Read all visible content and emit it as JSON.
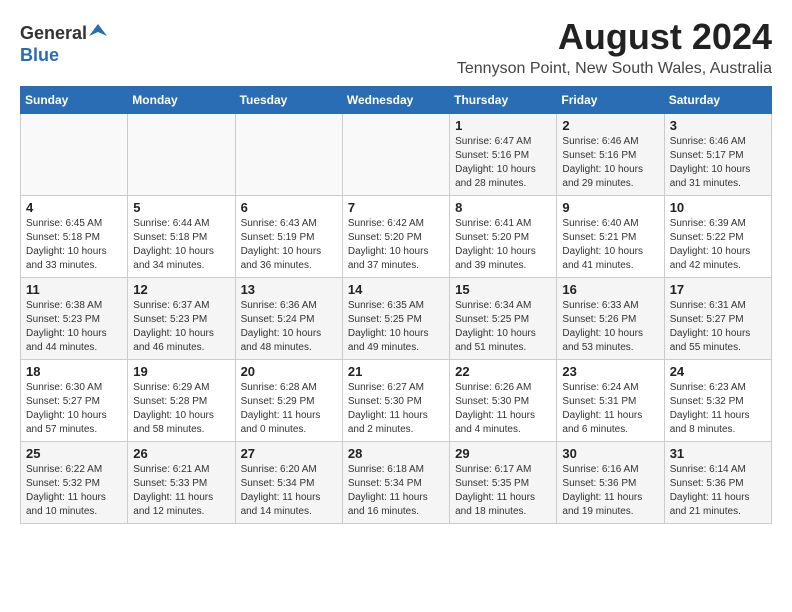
{
  "logo": {
    "general": "General",
    "blue": "Blue"
  },
  "title": "August 2024",
  "subtitle": "Tennyson Point, New South Wales, Australia",
  "calendar": {
    "headers": [
      "Sunday",
      "Monday",
      "Tuesday",
      "Wednesday",
      "Thursday",
      "Friday",
      "Saturday"
    ],
    "weeks": [
      [
        {
          "day": "",
          "info": ""
        },
        {
          "day": "",
          "info": ""
        },
        {
          "day": "",
          "info": ""
        },
        {
          "day": "",
          "info": ""
        },
        {
          "day": "1",
          "info": "Sunrise: 6:47 AM\nSunset: 5:16 PM\nDaylight: 10 hours\nand 28 minutes."
        },
        {
          "day": "2",
          "info": "Sunrise: 6:46 AM\nSunset: 5:16 PM\nDaylight: 10 hours\nand 29 minutes."
        },
        {
          "day": "3",
          "info": "Sunrise: 6:46 AM\nSunset: 5:17 PM\nDaylight: 10 hours\nand 31 minutes."
        }
      ],
      [
        {
          "day": "4",
          "info": "Sunrise: 6:45 AM\nSunset: 5:18 PM\nDaylight: 10 hours\nand 33 minutes."
        },
        {
          "day": "5",
          "info": "Sunrise: 6:44 AM\nSunset: 5:18 PM\nDaylight: 10 hours\nand 34 minutes."
        },
        {
          "day": "6",
          "info": "Sunrise: 6:43 AM\nSunset: 5:19 PM\nDaylight: 10 hours\nand 36 minutes."
        },
        {
          "day": "7",
          "info": "Sunrise: 6:42 AM\nSunset: 5:20 PM\nDaylight: 10 hours\nand 37 minutes."
        },
        {
          "day": "8",
          "info": "Sunrise: 6:41 AM\nSunset: 5:20 PM\nDaylight: 10 hours\nand 39 minutes."
        },
        {
          "day": "9",
          "info": "Sunrise: 6:40 AM\nSunset: 5:21 PM\nDaylight: 10 hours\nand 41 minutes."
        },
        {
          "day": "10",
          "info": "Sunrise: 6:39 AM\nSunset: 5:22 PM\nDaylight: 10 hours\nand 42 minutes."
        }
      ],
      [
        {
          "day": "11",
          "info": "Sunrise: 6:38 AM\nSunset: 5:23 PM\nDaylight: 10 hours\nand 44 minutes."
        },
        {
          "day": "12",
          "info": "Sunrise: 6:37 AM\nSunset: 5:23 PM\nDaylight: 10 hours\nand 46 minutes."
        },
        {
          "day": "13",
          "info": "Sunrise: 6:36 AM\nSunset: 5:24 PM\nDaylight: 10 hours\nand 48 minutes."
        },
        {
          "day": "14",
          "info": "Sunrise: 6:35 AM\nSunset: 5:25 PM\nDaylight: 10 hours\nand 49 minutes."
        },
        {
          "day": "15",
          "info": "Sunrise: 6:34 AM\nSunset: 5:25 PM\nDaylight: 10 hours\nand 51 minutes."
        },
        {
          "day": "16",
          "info": "Sunrise: 6:33 AM\nSunset: 5:26 PM\nDaylight: 10 hours\nand 53 minutes."
        },
        {
          "day": "17",
          "info": "Sunrise: 6:31 AM\nSunset: 5:27 PM\nDaylight: 10 hours\nand 55 minutes."
        }
      ],
      [
        {
          "day": "18",
          "info": "Sunrise: 6:30 AM\nSunset: 5:27 PM\nDaylight: 10 hours\nand 57 minutes."
        },
        {
          "day": "19",
          "info": "Sunrise: 6:29 AM\nSunset: 5:28 PM\nDaylight: 10 hours\nand 58 minutes."
        },
        {
          "day": "20",
          "info": "Sunrise: 6:28 AM\nSunset: 5:29 PM\nDaylight: 11 hours\nand 0 minutes."
        },
        {
          "day": "21",
          "info": "Sunrise: 6:27 AM\nSunset: 5:30 PM\nDaylight: 11 hours\nand 2 minutes."
        },
        {
          "day": "22",
          "info": "Sunrise: 6:26 AM\nSunset: 5:30 PM\nDaylight: 11 hours\nand 4 minutes."
        },
        {
          "day": "23",
          "info": "Sunrise: 6:24 AM\nSunset: 5:31 PM\nDaylight: 11 hours\nand 6 minutes."
        },
        {
          "day": "24",
          "info": "Sunrise: 6:23 AM\nSunset: 5:32 PM\nDaylight: 11 hours\nand 8 minutes."
        }
      ],
      [
        {
          "day": "25",
          "info": "Sunrise: 6:22 AM\nSunset: 5:32 PM\nDaylight: 11 hours\nand 10 minutes."
        },
        {
          "day": "26",
          "info": "Sunrise: 6:21 AM\nSunset: 5:33 PM\nDaylight: 11 hours\nand 12 minutes."
        },
        {
          "day": "27",
          "info": "Sunrise: 6:20 AM\nSunset: 5:34 PM\nDaylight: 11 hours\nand 14 minutes."
        },
        {
          "day": "28",
          "info": "Sunrise: 6:18 AM\nSunset: 5:34 PM\nDaylight: 11 hours\nand 16 minutes."
        },
        {
          "day": "29",
          "info": "Sunrise: 6:17 AM\nSunset: 5:35 PM\nDaylight: 11 hours\nand 18 minutes."
        },
        {
          "day": "30",
          "info": "Sunrise: 6:16 AM\nSunset: 5:36 PM\nDaylight: 11 hours\nand 19 minutes."
        },
        {
          "day": "31",
          "info": "Sunrise: 6:14 AM\nSunset: 5:36 PM\nDaylight: 11 hours\nand 21 minutes."
        }
      ]
    ]
  }
}
